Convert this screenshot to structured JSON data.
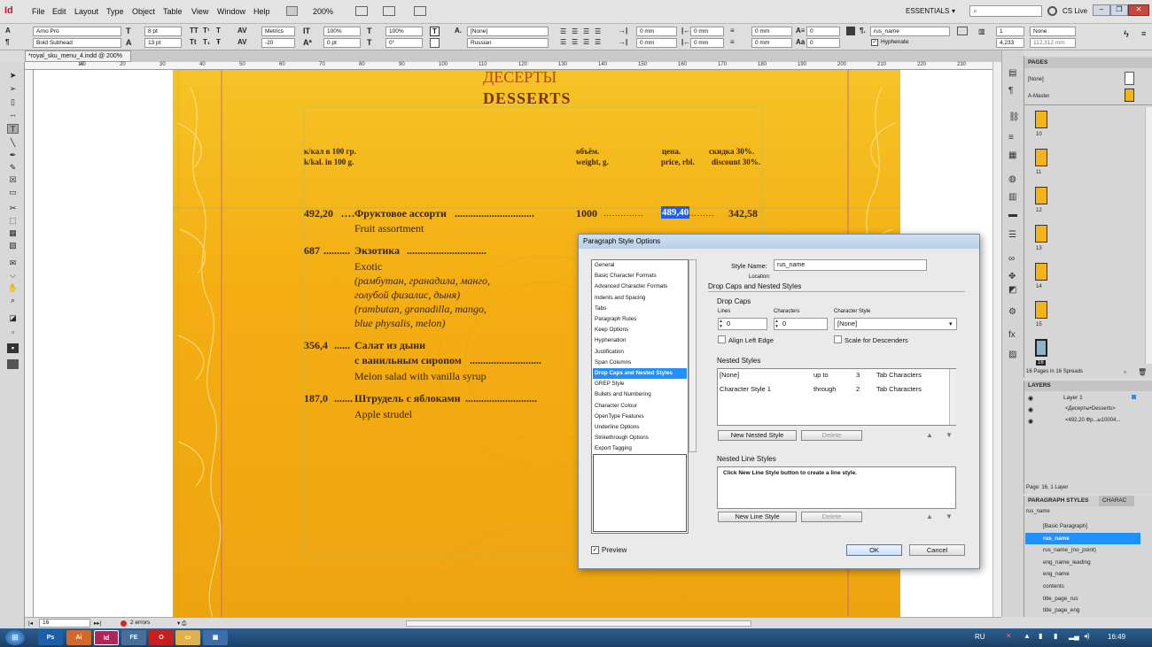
{
  "menu": {
    "items": [
      "File",
      "Edit",
      "Layout",
      "Type",
      "Object",
      "Table",
      "View",
      "Window",
      "Help"
    ],
    "zoom": "200%",
    "workspace": "ESSENTIALS",
    "cs_live": "CS Live"
  },
  "control": {
    "font_family": "Arno Pro",
    "font_style": "Bold Subhead",
    "font_size": "8 pt",
    "leading": "13 pt",
    "tracking": "100%",
    "kerning": "Metrics",
    "kerning_value": "-20",
    "horizontal_scale": "100%",
    "vertical_scale": "100%",
    "baseline": "0 pt",
    "skew": "0°",
    "char_style": "[None]",
    "language": "Russian",
    "indent_left": "0 mm",
    "indent_first": "0 mm",
    "indent_right": "0 mm",
    "space_before": "0 mm",
    "space_after": "0 mm",
    "drop_lines": "0",
    "drop_chars": "0",
    "para_style": "rus_name",
    "hyphenate": "Hyphenate",
    "columns": "1",
    "gutter": "4,233",
    "align_none": "None",
    "width_val": "112,312 mm"
  },
  "document": {
    "tab": "*royal_sku_menu_4.indd @ 200%",
    "ruler_numbers": [
      "10",
      "40",
      "20",
      "30",
      "40",
      "50",
      "60",
      "70",
      "80",
      "90",
      "100",
      "110",
      "120",
      "130",
      "140",
      "150",
      "160",
      "170",
      "180",
      "190",
      "200",
      "210",
      "220",
      "230"
    ]
  },
  "menu_page": {
    "title_ru": "ДЕСЕРТЫ",
    "title_en": "DESSERTS",
    "headers": {
      "ru_kcal": "к/кал в 100 гр.",
      "en_kcal": "k/kal. in 100 g.",
      "ru_weight": "объём.",
      "en_weight": "weight, g.",
      "ru_price": "цена.",
      "en_price": "price, rbl.",
      "ru_discount": "скидка 30%.",
      "en_discount": "discount 30%."
    },
    "item1": {
      "kcal": "492,20",
      "name_ru": "Фруктовое ассорти",
      "name_en": "Fruit assortment",
      "weight": "1000",
      "price": "489,40",
      "discount": "342,58"
    },
    "item2": {
      "kcal": "687",
      "name_ru": "Экзотика",
      "name_en": "Exotic",
      "desc_ru1": "(рамбутан, гранадила, манго,",
      "desc_ru2": "голубой физалис, дыня)",
      "desc_en1": "(rambutan, granadilla, mango,",
      "desc_en2": "blue physalis, melon)"
    },
    "item3": {
      "kcal": "356,4",
      "name_ru1": "Салат из дыни",
      "name_ru2": "с ванильным сиропом",
      "name_en": "Melon salad with vanilla syrup"
    },
    "item4": {
      "kcal": "187,0",
      "name_ru": "Штрудель с яблоками",
      "name_en": "Apple strudel"
    }
  },
  "dialog": {
    "title": "Paragraph Style Options",
    "categories": [
      "General",
      "Basic Character Formats",
      "Advanced Character Formats",
      "Indents and Spacing",
      "Tabs",
      "Paragraph Rules",
      "Keep Options",
      "Hyphenation",
      "Justification",
      "Span Columns",
      "Drop Caps and Nested Styles",
      "GREP Style",
      "Bullets and Numbering",
      "Character Colour",
      "OpenType Features",
      "Underline Options",
      "Strikethrough Options",
      "Export Tagging"
    ],
    "style_name_label": "Style Name:",
    "style_name": "rus_name",
    "location_label": "Location:",
    "section_title": "Drop Caps and Nested Styles",
    "drop_caps_title": "Drop Caps",
    "lines_label": "Lines",
    "lines_value": "0",
    "chars_label": "Characters",
    "chars_value": "0",
    "char_style_label": "Character Style",
    "char_style_value": "[None]",
    "align_left_edge": "Align Left Edge",
    "scale_descenders": "Scale for Descenders",
    "nested_title": "Nested Styles",
    "nested": [
      {
        "style": "[None]",
        "mode": "up to",
        "count": "3",
        "unit": "Tab Characters"
      },
      {
        "style": "Character Style 1",
        "mode": "through",
        "count": "2",
        "unit": "Tab Characters"
      }
    ],
    "new_nested": "New Nested Style",
    "delete": "Delete",
    "nested_line_title": "Nested Line Styles",
    "nested_line_hint": "Click New Line Style button to create a line style.",
    "new_line": "New Line Style",
    "preview": "Preview",
    "ok": "OK",
    "cancel": "Cancel"
  },
  "pages_panel": {
    "title": "PAGES",
    "none": "[None]",
    "master": "A-Master",
    "pages": [
      "10",
      "11",
      "12",
      "13",
      "14",
      "15",
      "16"
    ],
    "footer": "16 Pages in 16 Spreads"
  },
  "layers_panel": {
    "title": "LAYERS",
    "layer": "Layer 1",
    "items": [
      "<Десерты•Desserts>",
      "<492.20 Фр...ы10004..."
    ],
    "footer": "Page: 16, 1 Layer"
  },
  "para_styles_panel": {
    "title": "PARAGRAPH STYLES",
    "other_tab": "CHARAC",
    "current": "rus_name",
    "styles": [
      "[Basic Paragraph]",
      "rus_name",
      "rus_name_(no_point)",
      "eng_name_leading",
      "eng_name",
      "contents",
      "title_page_rus",
      "title_page_eng"
    ]
  },
  "status": {
    "page": "16",
    "errors": "2 errors"
  },
  "taskbar": {
    "lang": "RU",
    "time": "16:49"
  },
  "colors": {
    "accent": "#2f8ff0",
    "selected": "#1e90ff",
    "page_orange": "#f4ae12"
  }
}
